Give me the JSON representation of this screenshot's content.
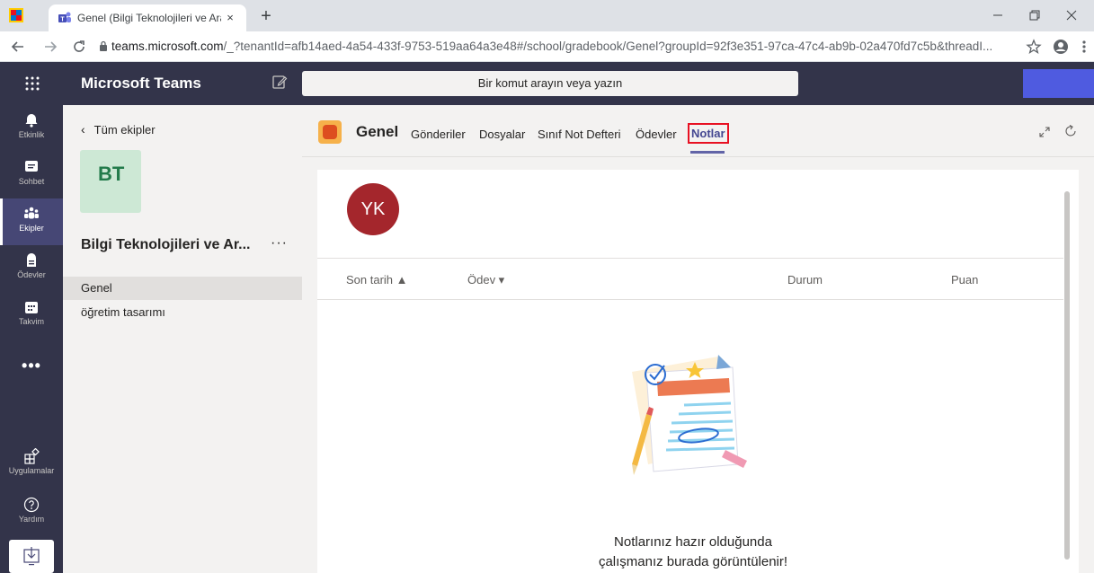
{
  "browser": {
    "tab_title": "Genel (Bilgi Teknolojileri ve Araçl",
    "tab_close": "×",
    "new_tab": "+",
    "url_domain": "teams.microsoft.com",
    "url_path": "/_?tenantId=afb14aed-4a54-433f-9753-519aa64a3e48#/school/gradebook/Genel?groupId=92f3e351-97ca-47c4-ab9b-02a470fd7c5b&threadI...",
    "icons": [
      "back-icon",
      "forward-icon",
      "reload-icon",
      "lock-icon",
      "star-icon",
      "account-icon",
      "menu-icon",
      "minimize-icon",
      "restore-icon",
      "close-icon"
    ]
  },
  "header": {
    "app_title": "Microsoft Teams",
    "search_placeholder": "Bir komut arayın veya yazın"
  },
  "appbar": {
    "items": [
      {
        "label": "Etkinlik",
        "icon": "bell-icon"
      },
      {
        "label": "Sohbet",
        "icon": "chat-icon"
      },
      {
        "label": "Ekipler",
        "icon": "teams-icon"
      },
      {
        "label": "Ödevler",
        "icon": "assignments-icon"
      },
      {
        "label": "Takvim",
        "icon": "calendar-icon"
      },
      {
        "label": "Uygulamalar",
        "icon": "apps-icon"
      },
      {
        "label": "Yardım",
        "icon": "help-icon"
      }
    ],
    "more": "•••"
  },
  "team_sidebar": {
    "back_label": "Tüm ekipler",
    "team_initials": "BT",
    "team_name": "Bilgi Teknolojileri ve Ar...",
    "team_more": "···",
    "channels": [
      "Genel",
      "öğretim tasarımı"
    ]
  },
  "channel": {
    "title": "Genel",
    "tabs": [
      "Gönderiler",
      "Dosyalar",
      "Sınıf Not Defteri",
      "Ödevler",
      "Notlar"
    ],
    "active_tab": "Notlar"
  },
  "gradebook": {
    "user_initials": "YK",
    "columns": [
      "Son tarih ▲",
      "Ödev ▾",
      "Durum",
      "Puan"
    ],
    "empty_line1": "Notlarınız hazır olduğunda",
    "empty_line2": "çalışmanız burada görüntülenir!"
  },
  "colors": {
    "teams_dark": "#33344a",
    "accent": "#6264a7",
    "highlight_box": "#e81123",
    "avatar_red": "#a4262c",
    "team_tile": "#cde8d5"
  }
}
